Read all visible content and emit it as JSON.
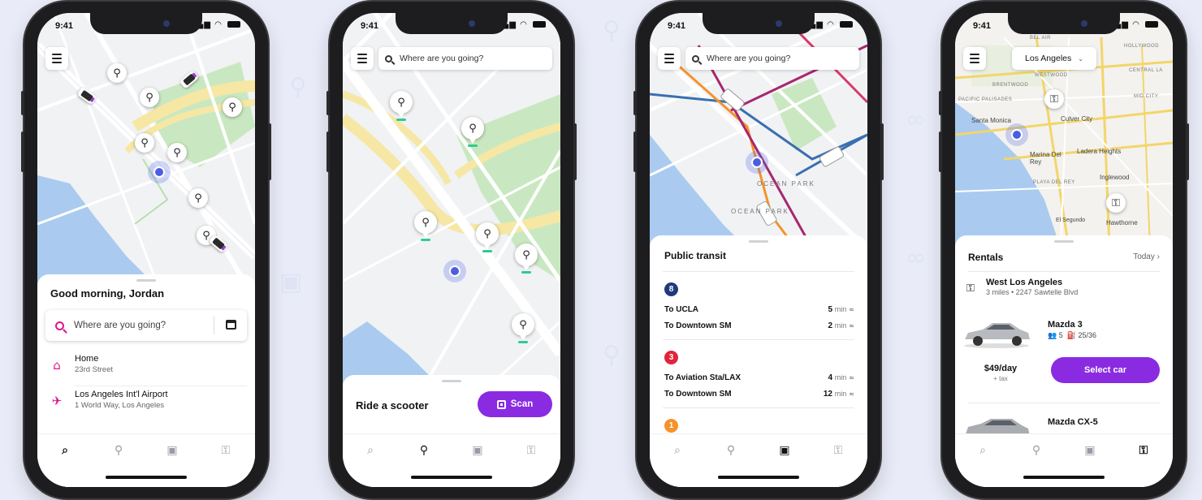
{
  "status_time": "9:41",
  "colors": {
    "accent": "#8a2be2",
    "pink": "#e0148c",
    "map_land": "#f1f2f4",
    "map_water": "#aacbef",
    "map_park": "#c9e8c1",
    "map_highway": "#f6e7a4"
  },
  "tabbar": {
    "icons": [
      "search-icon",
      "scooter-icon",
      "transit-icon",
      "rental-key-icon"
    ]
  },
  "screen1": {
    "greeting": "Good morning, Jordan",
    "search_placeholder": "Where are you going?",
    "places": [
      {
        "title": "Home",
        "subtitle": "23rd Street",
        "icon": "home-icon"
      },
      {
        "title": "Los Angeles Int'l Airport",
        "subtitle": "1 World Way, Los Angeles",
        "icon": "airplane-icon"
      }
    ]
  },
  "screen2": {
    "search_placeholder": "Where are you going?",
    "title": "Ride a scooter",
    "scan_label": "Scan"
  },
  "screen3": {
    "search_placeholder": "Where are you going?",
    "title": "Public transit",
    "map_labels": [
      "OCEAN PARK",
      "OCEAN PARK"
    ],
    "routes": [
      {
        "number": "8",
        "color": "#1e3a7a",
        "trips": [
          {
            "dest": "To UCLA",
            "eta_value": "5",
            "eta_unit": "min"
          },
          {
            "dest": "To Downtown SM",
            "eta_value": "2",
            "eta_unit": "min"
          }
        ]
      },
      {
        "number": "3",
        "color": "#e0243a",
        "trips": [
          {
            "dest": "To Aviation Sta/LAX",
            "eta_value": "4",
            "eta_unit": "min"
          },
          {
            "dest": "To Downtown SM",
            "eta_value": "12",
            "eta_unit": "min"
          }
        ]
      },
      {
        "number": "1",
        "color": "#f5922a",
        "trips": []
      }
    ]
  },
  "screen4": {
    "city": "Los Angeles",
    "map_labels": [
      "BEL AIR",
      "HOLLYWOOD",
      "WESTWOOD",
      "CENTRAL LA",
      "BRENTWOOD",
      "PACIFIC PALISADES",
      "MID CITY",
      "Santa Monica",
      "Culver City",
      "Marina Del Rey",
      "Ladera Heights",
      "Inglewood",
      "PLAYA DEL REY",
      "El Segundo",
      "Hawthorne"
    ],
    "title": "Rentals",
    "date_label": "Today",
    "branch": {
      "name": "West Los Angeles",
      "address": "3 miles • 2247 Sawtelle Blvd"
    },
    "cars": [
      {
        "model": "Mazda 3",
        "seats": "5",
        "mpg": "25/36",
        "price": "$49/day",
        "price_note": "+ tax",
        "button": "Select car"
      },
      {
        "model": "Mazda CX-5"
      }
    ]
  }
}
